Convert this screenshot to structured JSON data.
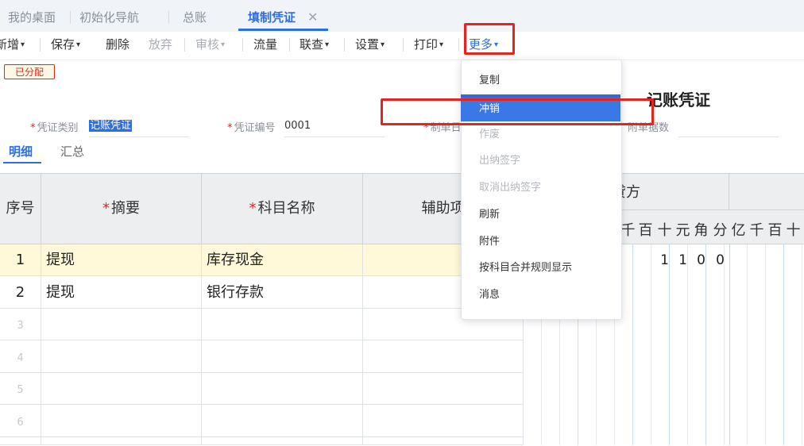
{
  "tabs": [
    {
      "label": "我的桌面"
    },
    {
      "label": "初始化导航"
    },
    {
      "label": "总账"
    },
    {
      "label": "填制凭证"
    }
  ],
  "tab_close_glyph": "✕",
  "toolbar": {
    "add": "新增",
    "save": "保存",
    "delete": "删除",
    "discard": "放弃",
    "review": "审核",
    "flow": "流量",
    "linked": "联查",
    "settings": "设置",
    "print": "打印",
    "more": "更多"
  },
  "caret_glyph": "▾",
  "status_badge": "已分配",
  "voucher_title": "记账凭证",
  "form": {
    "req_mark": "*",
    "voucher_type_label": "凭证类别",
    "voucher_type_value": "记账凭证",
    "voucher_no_label": "凭证编号",
    "voucher_no_value": "0001",
    "maker_label": "制单日",
    "attach_label": "附单据数"
  },
  "subtabs": {
    "detail": "明细",
    "summary": "汇总"
  },
  "grid": {
    "headers": {
      "seq": "序号",
      "summary": "摘要",
      "account": "科目名称",
      "aux": "辅助项",
      "credit": "贷方",
      "req_mark": "*"
    },
    "digit_headers_left": [
      "千",
      "百",
      "十",
      "元",
      "角",
      "分"
    ],
    "digit_headers_right": [
      "亿",
      "千",
      "百",
      "十"
    ],
    "rows": [
      {
        "seq": "1",
        "summary": "提现",
        "account": "库存现金"
      },
      {
        "seq": "2",
        "summary": "提现",
        "account": "银行存款"
      },
      {
        "seq": "3"
      },
      {
        "seq": "4"
      },
      {
        "seq": "5"
      },
      {
        "seq": "6"
      }
    ],
    "row1_amount_digits": [
      "1",
      "1",
      "0",
      "0"
    ]
  },
  "dropdown": {
    "items": [
      {
        "label": "复制",
        "state": "normal"
      },
      {
        "label": "冲销",
        "state": "highlighted"
      },
      {
        "label": "作废",
        "state": "disabled"
      },
      {
        "label": "出纳签字",
        "state": "disabled"
      },
      {
        "label": "取消出纳签字",
        "state": "disabled"
      },
      {
        "label": "刷新",
        "state": "normal"
      },
      {
        "label": "附件",
        "state": "normal"
      },
      {
        "label": "按科目合并规则显示",
        "state": "normal"
      },
      {
        "label": "消息",
        "state": "normal"
      }
    ]
  },
  "colors": {
    "accent": "#2d6fe0",
    "highlight_annotation": "#e8231d",
    "selected_row_bg": "#fff8d9",
    "header_bg": "#eceef0"
  }
}
